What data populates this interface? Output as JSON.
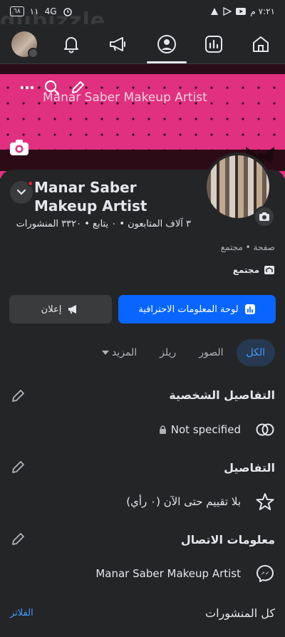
{
  "status_bar": {
    "time": "٧:٢١ م",
    "battery": "٦٨",
    "network": "4G",
    "signal_left": "١١",
    "signal_right": "",
    "watermark": "dubizzle"
  },
  "top_nav": {
    "items": [
      "avatar",
      "notifications",
      "announcements",
      "profile",
      "dashboard",
      "home"
    ]
  },
  "cover": {
    "title": "Manar Saber Makeup Artist"
  },
  "profile": {
    "name": "Manar Saber Makeup Artist",
    "stats": "٣ آلاف المتابعون • ٠ يتابع • ٣٣٢٠ المنشورات",
    "meta": "صفحة • مجتمع",
    "category": "مجتمع"
  },
  "buttons": {
    "dashboard": "لوحة المعلومات الاحترافية",
    "ad": "إعلان"
  },
  "tabs": [
    {
      "label": "الكل",
      "active": true
    },
    {
      "label": "الصور",
      "active": false
    },
    {
      "label": "ريلز",
      "active": false
    },
    {
      "label": "المزيد",
      "active": false
    }
  ],
  "sections": {
    "personal_details": {
      "title": "التفاصيل الشخصية",
      "value": "Not specified"
    },
    "details": {
      "title": "التفاصيل",
      "value": "بلا تقييم حتى الآن (٠ رأي)"
    },
    "contact": {
      "title": "معلومات الاتصال",
      "value": "Manar Saber Makeup Artist"
    }
  },
  "footer_row": {
    "all_posts": "كل المنشورات",
    "filters": "الفلاتر"
  },
  "colors": {
    "background": "#242527",
    "accent_blue": "#0866ff",
    "link_blue": "#4599ff",
    "cover_pink": "#e0307f"
  }
}
